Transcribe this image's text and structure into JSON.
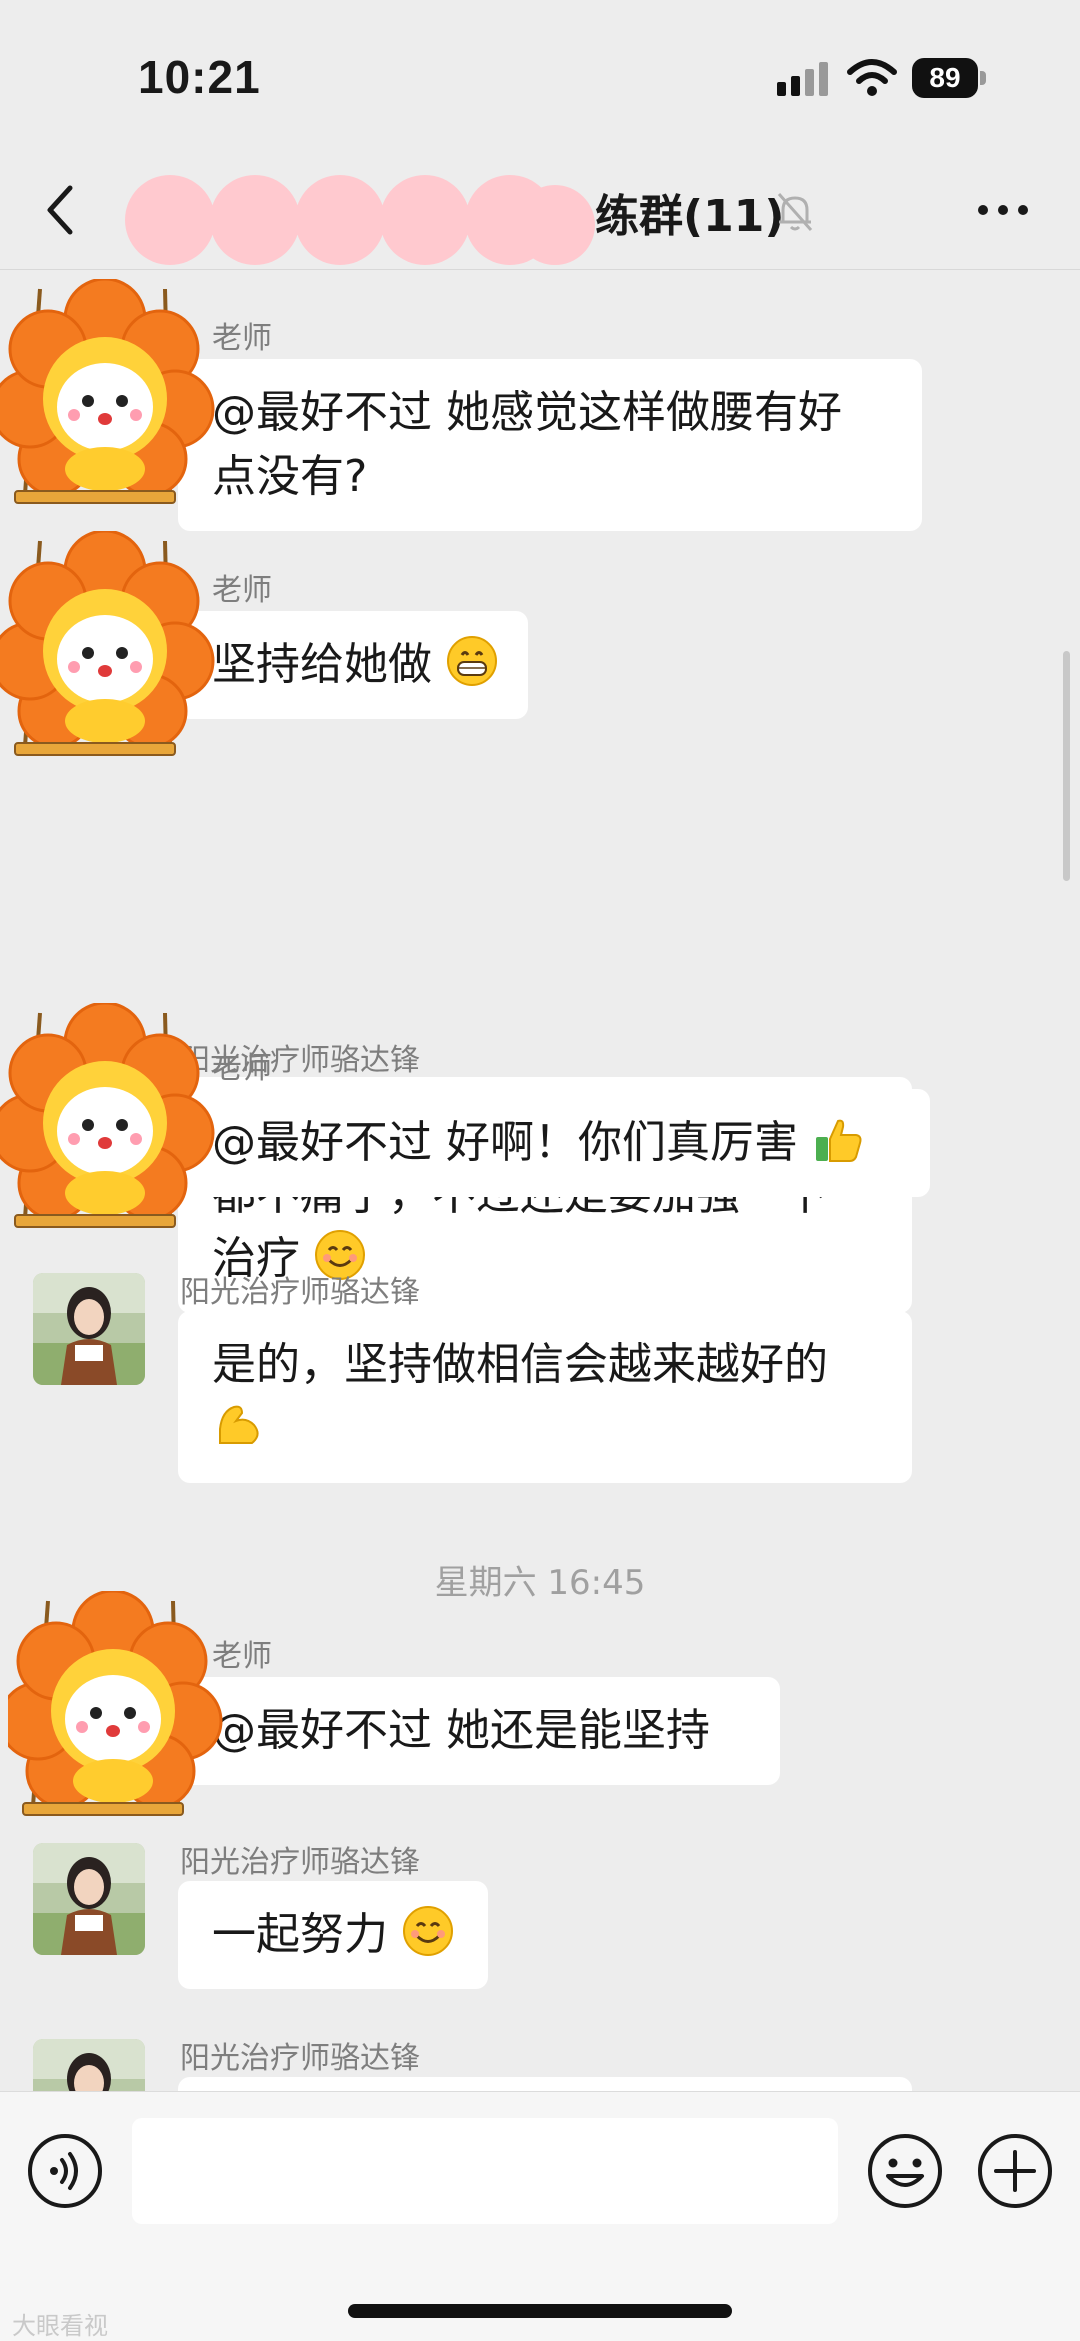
{
  "status_bar": {
    "time": "10:21",
    "battery": "89"
  },
  "header": {
    "title": "练群(11)"
  },
  "messages": [
    {
      "sender": "老师",
      "text": "@最好不过 她感觉这样做腰有好\n点没有?"
    },
    {
      "sender": "老师",
      "text": "坚持给她做"
    },
    {
      "sender": "阳光治疗师骆达锋",
      "text": "有好点，现在陈老师的腰基本上\n都不痛了，不过还是要加强一下\n治疗"
    },
    {
      "sender": "老师",
      "text": "@最好不过 好啊！你们真厉害"
    },
    {
      "sender": "阳光治疗师骆达锋",
      "text": "是的，坚持做相信会越来越好的"
    },
    {
      "sender": "老师",
      "text": "@最好不过 她还是能坚持"
    },
    {
      "sender": "阳光治疗师骆达锋",
      "text": "一起努力"
    },
    {
      "sender": "阳光治疗师骆达锋",
      "text": ""
    }
  ],
  "timestamp": "星期六 16:45",
  "watermark": "大眼看视",
  "icons": [
    "signal-icon",
    "wifi-icon",
    "back-icon",
    "mute-bell-icon",
    "more-icon",
    "voice-icon",
    "emoji-icon",
    "plus-icon",
    "grin-emoji",
    "smile-emoji",
    "thumbs-up-emoji",
    "muscle-emoji"
  ],
  "colors": {
    "background": "#ededed",
    "bubble": "#ffffff",
    "name": "#7e7e7e",
    "mask": "#ffc9cf",
    "flower": "#f47b20"
  }
}
